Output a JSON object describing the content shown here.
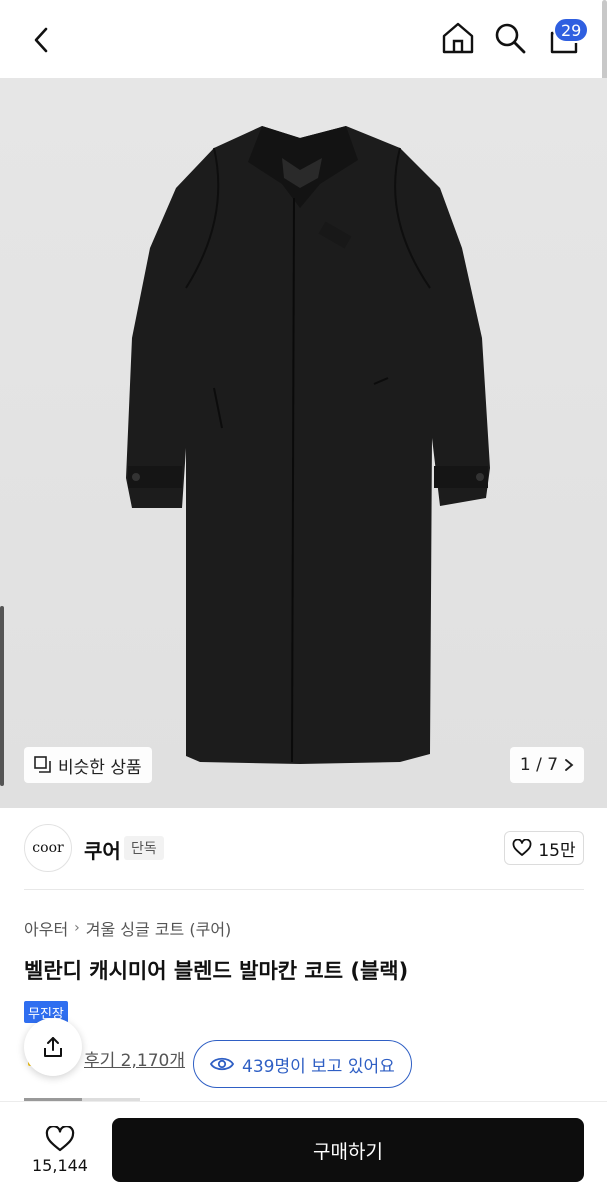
{
  "header": {
    "back_icon": "chevron-left-icon",
    "home_icon": "home-icon",
    "search_icon": "search-icon",
    "cart_icon": "cart-icon",
    "cart_count": "29"
  },
  "gallery": {
    "similar_label": "비슷한 상품",
    "counter": "1 / 7"
  },
  "brand": {
    "logo_text": "coor",
    "name": "쿠어",
    "badge": "단독",
    "likes": "15만"
  },
  "product": {
    "breadcrumb": [
      "아우터",
      "겨울 싱글 코트 (쿠어)"
    ],
    "title": "벨란디 캐시미어 블렌드 발마칸 코트 (블랙)",
    "shipping_badge": "무진장",
    "reviews": "후기 2,170개",
    "viewers": "439명이 보고 있어요"
  },
  "bottom": {
    "wish_count": "15,144",
    "buy_label": "구매하기"
  },
  "colors": {
    "accent_blue": "#2f5fe0",
    "buy_button": "#0d0d0d"
  }
}
